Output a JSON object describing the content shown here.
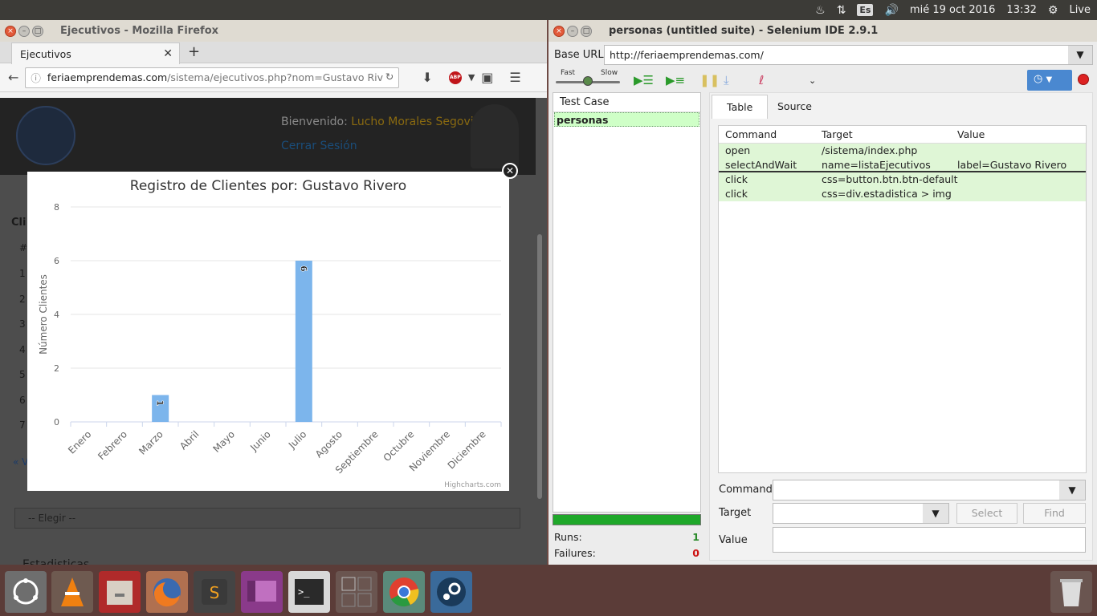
{
  "topbar": {
    "keyboard": "Es",
    "datetime": "mié 19 oct 2016",
    "time": "13:32",
    "session": "Live"
  },
  "firefox": {
    "title": "Ejecutivos - Mozilla Firefox",
    "tab_label": "Ejecutivos",
    "url_host": "feriaemprendemas.com",
    "url_path": "/sistema/ejecutivos.php?nom=Gustavo Rivei",
    "abp_label": "ABP",
    "page": {
      "welcome_label": "Bienvenido:",
      "user_name": "Lucho Morales Segovia",
      "logout": "Cerrar Sesión",
      "select_placeholder": "-- Elegir --",
      "section": "Estadisticas",
      "bg_header": "Cli",
      "bg_hash": "#",
      "bg_rows": [
        "1",
        "2",
        "3",
        "4",
        "5",
        "6",
        "7"
      ],
      "back_link": "« V"
    }
  },
  "chart_data": {
    "type": "bar",
    "title": "Registro de Clientes por: Gustavo Rivero",
    "xlabel": "",
    "ylabel": "Número Clientes",
    "categories": [
      "Enero",
      "Febrero",
      "Marzo",
      "Abril",
      "Mayo",
      "Junio",
      "Julio",
      "Agosto",
      "Septiembre",
      "Octubre",
      "Noviembre",
      "Diciembre"
    ],
    "values": [
      0,
      0,
      1,
      0,
      0,
      0,
      6,
      0,
      0,
      0,
      0,
      0
    ],
    "data_labels": [
      "",
      "",
      "1",
      "",
      "",
      "",
      "6",
      "",
      "",
      "",
      "",
      ""
    ],
    "ylim": [
      0,
      8
    ],
    "yticks": [
      0,
      2,
      4,
      6,
      8
    ],
    "grid": true,
    "legend": "none",
    "bar_color": "#7cb5ec",
    "credit": "Highcharts.com"
  },
  "selenium": {
    "title": "personas (untitled suite) - Selenium IDE 2.9.1",
    "base_url_label": "Base URL",
    "base_url": "http://feriaemprendemas.com/",
    "speed_fast": "Fast",
    "speed_slow": "Slow",
    "test_case_header": "Test Case",
    "test_case": "personas",
    "tab_table": "Table",
    "tab_source": "Source",
    "columns": [
      "Command",
      "Target",
      "Value"
    ],
    "rows": [
      {
        "command": "open",
        "target": "/sistema/index.php",
        "value": ""
      },
      {
        "command": "selectAndWait",
        "target": "name=listaEjecutivos",
        "value": "label=Gustavo Rivero"
      },
      {
        "command": "click",
        "target": "css=button.btn.btn-default",
        "value": ""
      },
      {
        "command": "click",
        "target": "css=div.estadistica > img",
        "value": ""
      }
    ],
    "command_label": "Command",
    "target_label": "Target",
    "value_label": "Value",
    "select_btn": "Select",
    "find_btn": "Find",
    "runs_label": "Runs:",
    "runs": "1",
    "failures_label": "Failures:",
    "failures": "0"
  },
  "dock": {
    "items": [
      "ubuntu-icon",
      "vlc-icon",
      "files-icon",
      "firefox-icon",
      "sublime-icon",
      "remmina-icon",
      "terminal-icon",
      "workspaces-icon",
      "chrome-icon",
      "steam-icon",
      "trash-icon"
    ]
  }
}
